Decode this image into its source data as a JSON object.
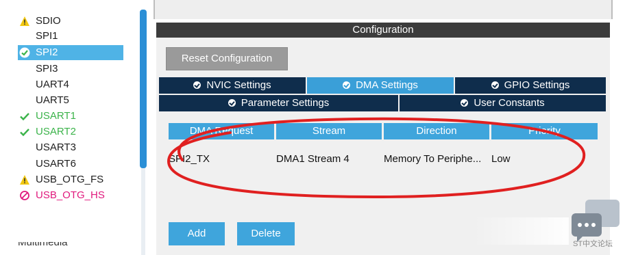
{
  "peripherals": [
    {
      "label": "SDIO",
      "status": "warning"
    },
    {
      "label": "SPI1",
      "status": "none"
    },
    {
      "label": "SPI2",
      "status": "selected-ok"
    },
    {
      "label": "SPI3",
      "status": "none"
    },
    {
      "label": "UART4",
      "status": "none"
    },
    {
      "label": "UART5",
      "status": "none"
    },
    {
      "label": "USART1",
      "status": "ok"
    },
    {
      "label": "USART2",
      "status": "ok"
    },
    {
      "label": "USART3",
      "status": "none"
    },
    {
      "label": "USART6",
      "status": "none"
    },
    {
      "label": "USB_OTG_FS",
      "status": "warning"
    },
    {
      "label": "USB_OTG_HS",
      "status": "disabled"
    }
  ],
  "partial_item": "Multimedia",
  "panel": {
    "header": "Configuration",
    "reset_label": "Reset Configuration",
    "tabs_row1": [
      "NVIC Settings",
      "DMA Settings",
      "GPIO Settings"
    ],
    "tabs_row2": [
      "Parameter Settings",
      "User Constants"
    ],
    "active_tab": "DMA Settings"
  },
  "dma_table": {
    "headers": [
      "DMA Request",
      "Stream",
      "Direction",
      "Priority"
    ],
    "rows": [
      {
        "request": "SPI2_TX",
        "stream": "DMA1 Stream 4",
        "direction": "Memory To Periphe...",
        "priority": "Low"
      }
    ]
  },
  "buttons": {
    "add": "Add",
    "delete": "Delete"
  },
  "watermark": {
    "text": "ST中文论坛"
  },
  "colors": {
    "accent": "#3fa5dc",
    "tab_dark": "#0f2d4c",
    "ok_green": "#3bb34a",
    "warn_yellow": "#f2c811",
    "error_pink": "#e0197d",
    "annotation_red": "#e02020"
  }
}
